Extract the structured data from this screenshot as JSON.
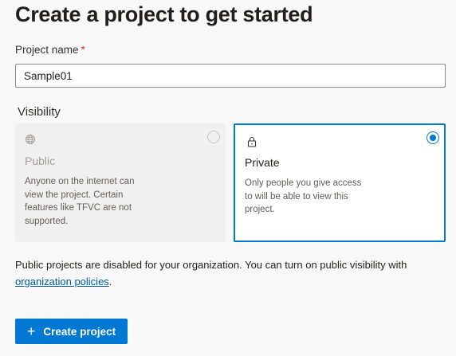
{
  "page": {
    "title": "Create a project to get started"
  },
  "project_name": {
    "label": "Project name",
    "required_marker": "*",
    "value": "Sample01"
  },
  "visibility": {
    "label": "Visibility",
    "options": [
      {
        "icon": "globe-icon",
        "title": "Public",
        "description": "Anyone on the internet can view the project. Certain features like TFVC are not supported.",
        "selected": false,
        "disabled": true
      },
      {
        "icon": "lock-icon",
        "title": "Private",
        "description": "Only people you give access to will be able to view this project.",
        "selected": true,
        "disabled": false
      }
    ]
  },
  "notice": {
    "text": "Public projects are disabled for your organization. You can turn on public visibility with",
    "link_text": "organization policies",
    "suffix": "."
  },
  "create_button": {
    "icon": "plus-icon",
    "label": "Create project"
  },
  "colors": {
    "accent": "#0078d4",
    "link": "#005a9e",
    "required": "#d13438"
  }
}
